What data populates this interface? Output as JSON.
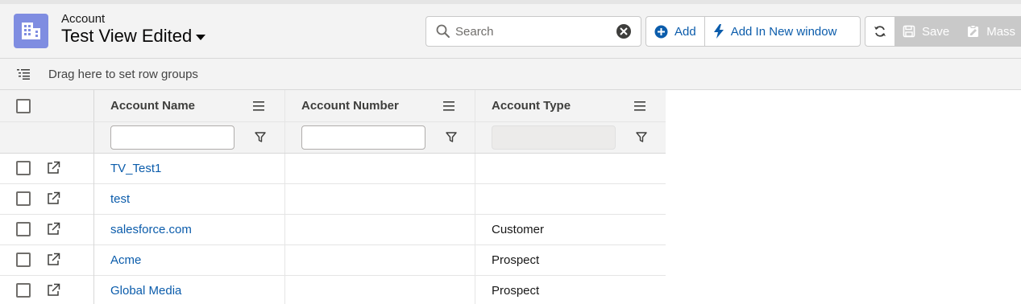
{
  "header": {
    "object_label": "Account",
    "view_title": "Test View Edited"
  },
  "search": {
    "placeholder": "Search",
    "value": ""
  },
  "toolbar": {
    "add_label": "Add",
    "add_new_window_label": "Add In New window",
    "save_label": "Save",
    "mass_label": "Mass"
  },
  "row_groups": {
    "hint": "Drag here to set row groups"
  },
  "grid": {
    "columns": [
      {
        "label": "Account Name"
      },
      {
        "label": "Account Number"
      },
      {
        "label": "Account Type"
      }
    ],
    "rows": [
      {
        "name": "TV_Test1",
        "number": "",
        "type": ""
      },
      {
        "name": "test",
        "number": "",
        "type": ""
      },
      {
        "name": "salesforce.com",
        "number": "",
        "type": "Customer"
      },
      {
        "name": "Acme",
        "number": "",
        "type": "Prospect"
      },
      {
        "name": "Global Media",
        "number": "",
        "type": "Prospect"
      }
    ]
  },
  "colors": {
    "brand_icon": "#7f8de1",
    "link": "#0b5cab",
    "header_bg": "#f3f3f3",
    "disabled_bg": "#c9c9c9"
  },
  "icons": {
    "object": "building-icon",
    "search": "search-icon",
    "clear": "clear-icon",
    "add": "add-circle-icon",
    "new_window": "lightning-icon",
    "refresh": "refresh-icon",
    "save": "save-icon",
    "mass": "mass-edit-icon",
    "row_group": "row-group-icon",
    "column_menu": "menu-icon",
    "filter": "filter-icon",
    "open_record": "open-record-icon"
  }
}
